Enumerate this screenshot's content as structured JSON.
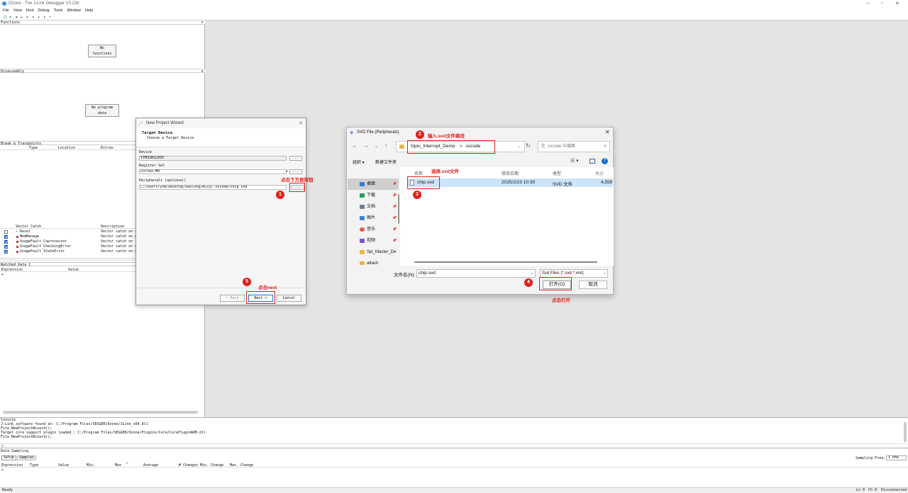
{
  "app": {
    "title": "Ozone - The J-Link Debugger V3.22b",
    "menu": [
      "File",
      "View",
      "Find",
      "Debug",
      "Tools",
      "Window",
      "Help"
    ]
  },
  "panels": {
    "functions": {
      "title": "Functions",
      "empty": "No functions"
    },
    "disassembly": {
      "title": "Disassembly",
      "empty": "No program data"
    },
    "breakpoints": {
      "title": "Break & Tracepoints",
      "columns": [
        "Type",
        "Location",
        "Extras"
      ]
    },
    "vector_catch": {
      "columns": [
        "Vector Catch",
        "Description"
      ],
      "rows": [
        {
          "name": "Reset",
          "desc": "Vector catch on co",
          "checked": false
        },
        {
          "name": "MemManage",
          "desc": "Vector catch on me",
          "checked": true
        },
        {
          "name": "UsageFault_Coprocessor",
          "desc": "Vector catch on fa",
          "checked": true
        },
        {
          "name": "UsageFault_CheckingError",
          "desc": "Vector catch on un",
          "checked": true
        },
        {
          "name": "UsageFault_StateError",
          "desc": "Vector catch on us",
          "checked": true
        }
      ]
    },
    "watched": {
      "title": "Watched Data 1",
      "columns": [
        "Expression",
        "Value"
      ],
      "new_row": "+"
    },
    "console": {
      "title": "Console",
      "lines": [
        "J-Link software found at: C:/Program Files/SEGGER/Ozone/JLink_x64.dll",
        "File.NewProjectWizard();",
        "Target core support plugin loaded.: C:/Program Files/SEGGER/Ozone/Plugins/Core/CorePluginARM.dll",
        "File.NewProjectWizard();"
      ],
      "prompt": ">"
    },
    "sampling": {
      "title": "Data Sampling",
      "tabs": [
        "Setup",
        "Samples"
      ],
      "freq_label": "Sampling Freq:",
      "freq_value": "1 kHz",
      "columns": [
        "Expression",
        "Type",
        "Value",
        "Min.",
        "Max",
        "Average",
        "# Changes",
        "Min. Change",
        "Max. Change"
      ],
      "new_row": "+"
    }
  },
  "status": {
    "left": "Ready",
    "ln": "Ln 0",
    "ch": "Ch 0",
    "conn": "Disconnected"
  },
  "wizard": {
    "title": "New Project Wizard",
    "heading": "Target Device",
    "subheading": "Choose a Target Device",
    "device_label": "Device",
    "device_value": "YTM32B1LE05",
    "register_label": "Register Set",
    "register_value": "Cortex-M0",
    "peripherals_label": "Peripherals (optional)",
    "peripherals_value": "C:/Users/ytm/Desktop/baolong/MCU3/.vscode/chip.svd",
    "browse": "...",
    "back": "< Back",
    "next": "Next >",
    "cancel": "Cancel"
  },
  "file_dialog": {
    "title": "SVD File (Peripherals)",
    "path": [
      "Gpio_Interrupt_Demo",
      ">",
      ".vscode"
    ],
    "search_placeholder": "在 .vscode 中搜索",
    "organize": "组织 ▾",
    "new_folder": "新建文件夹",
    "sidebar": [
      {
        "label": "桌面",
        "color": "#3a7bd5",
        "pinned": true
      },
      {
        "label": "下载",
        "color": "#2a9d5a",
        "pinned": true
      },
      {
        "label": "文档",
        "color": "#6d7f95",
        "pinned": true
      },
      {
        "label": "图片",
        "color": "#3a87c8",
        "pinned": true
      },
      {
        "label": "音乐",
        "color": "#e2574c",
        "pinned": true
      },
      {
        "label": "视频",
        "color": "#7a55c8",
        "pinned": true
      },
      {
        "label": "Spi_Master_De",
        "color": "#e6b84a",
        "pinned": false
      },
      {
        "label": "attach",
        "color": "#e6b84a",
        "pinned": false
      }
    ],
    "columns": [
      "名称",
      "修改日期",
      "类型",
      "大小"
    ],
    "files": [
      {
        "name": "chip.svd",
        "date": "2025/2/23 10:39",
        "type": "SVD 文件",
        "size": "4,558"
      }
    ],
    "filename_label": "文件名(N):",
    "filename_value": "chip.svd",
    "filter": "Svd Files (*.svd *.xml)",
    "open": "打开(O)",
    "cancel": "取消"
  },
  "annotations": {
    "a1": {
      "num": "1",
      "text": "点击下方按按钮"
    },
    "a2": {
      "num": "2",
      "text": "输入.svd文件路径"
    },
    "a3": {
      "num": "3",
      "text": "选择.svd文件"
    },
    "a4": {
      "num": "4",
      "text": "点击打开"
    },
    "a5": {
      "num": "5",
      "text": "点击next"
    }
  },
  "colors": {
    "annotation": "#e0201b",
    "selection": "#cce4f7",
    "checkbox": "#1a5fd0"
  }
}
